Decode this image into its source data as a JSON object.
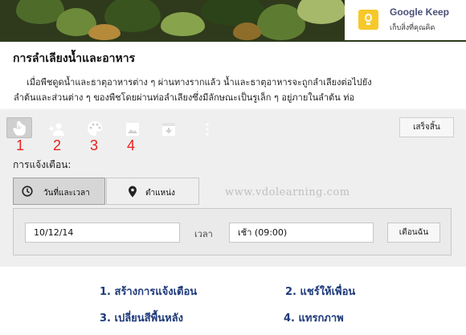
{
  "keep": {
    "title": "Google Keep",
    "subtitle": "เก็บสิ่งที่คุณคิด"
  },
  "note": {
    "title": "การลำเลียงน้ำและอาหาร",
    "body_line1": "เมื่อพืชดูดน้ำและธาตุอาหารต่าง ๆ ผ่านทางรากแล้ว น้ำและธาตุอาหารจะถูกลำเลียงต่อไปยัง",
    "body_line2": "ลำต้นและส่วนต่าง ๆ ของพืชโดยผ่านท่อลำเลียงซึ่งมีลักษณะเป็นรูเล็ก ๆ อยู่ภายในลำต้น ท่อ"
  },
  "toolbar": {
    "icons": [
      "remind-me-icon",
      "collaborator-icon",
      "palette-icon",
      "image-icon",
      "archive-icon",
      "more-icon"
    ],
    "numbers": [
      "1",
      "2",
      "3",
      "4"
    ],
    "done_label": "เสร็จสิ้น"
  },
  "reminder": {
    "label": "การแจ้งเตือน:",
    "tab_date": "วันที่และเวลา",
    "tab_location": "ตำแหน่ง",
    "date_value": "10/12/14",
    "time_label": "เวลา",
    "time_value": "เช้า (09:00)",
    "remind_button": "เตือนฉัน"
  },
  "watermark": "www.vdolearning.com",
  "legend": {
    "item1": "1. สร้างการแจ้งเตือน",
    "item2": "2. แชร์ให้เพื่อน",
    "item3": "3. เปลี่ยนสีพื้นหลัง",
    "item4": "4. แทรกภาพ"
  },
  "colors": {
    "accent_red": "#e8221f",
    "legend_blue": "#1f3a7a",
    "keep_yellow": "#f7c82a"
  }
}
